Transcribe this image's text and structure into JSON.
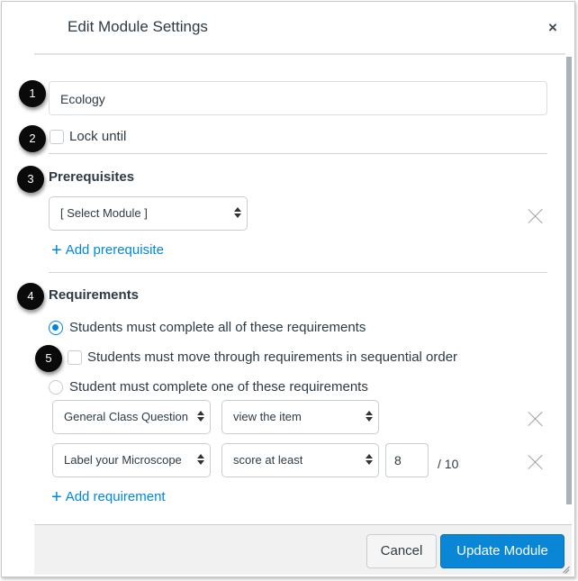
{
  "dialog": {
    "title": "Edit Module Settings",
    "close_label": "×"
  },
  "badges": [
    "1",
    "2",
    "3",
    "4",
    "5"
  ],
  "module_name": {
    "value": "Ecology"
  },
  "lock_until": {
    "label": "Lock until",
    "checked": false
  },
  "prerequisites": {
    "heading": "Prerequisites",
    "items": [
      {
        "selected": "[ Select Module ]"
      }
    ],
    "add_label": "Add prerequisite",
    "add_icon": "plus-icon"
  },
  "requirements": {
    "heading": "Requirements",
    "option_all": {
      "label": "Students must complete all of these requirements",
      "selected": true
    },
    "sequential": {
      "label": "Students must move through requirements in sequential order",
      "checked": false
    },
    "option_one": {
      "label": "Student must complete one of these requirements",
      "selected": false
    },
    "items": [
      {
        "item": "General Class Question a",
        "condition": "view the item"
      },
      {
        "item": "Label your Microscope",
        "condition": "score at least",
        "score": "8",
        "out_of": "/ 10"
      }
    ],
    "add_label": "Add requirement",
    "add_icon": "plus-icon"
  },
  "footer": {
    "cancel_label": "Cancel",
    "update_label": "Update Module"
  },
  "colors": {
    "accent": "#0a86d7",
    "link": "#0088d8",
    "badge": "#0a0a0a",
    "footer_bg": "#f1f1f1"
  }
}
